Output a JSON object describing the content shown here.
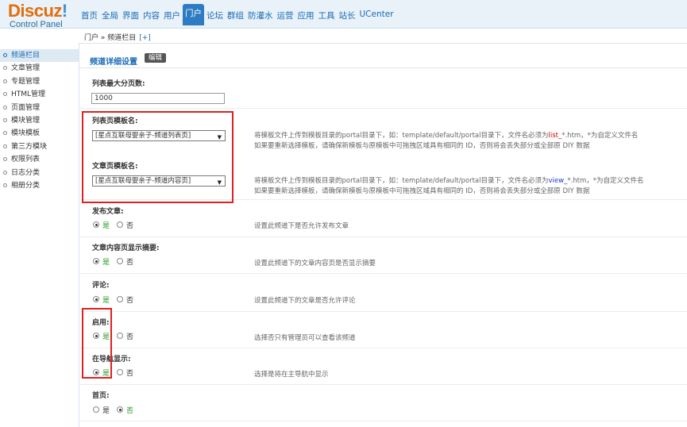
{
  "logo": {
    "main": "Discuz",
    "excl": "!",
    "sub": "Control Panel"
  },
  "topnav": [
    {
      "label": "首页",
      "active": false
    },
    {
      "label": "全局",
      "active": false
    },
    {
      "label": "界面",
      "active": false
    },
    {
      "label": "内容",
      "active": false
    },
    {
      "label": "用户",
      "active": false
    },
    {
      "label": "门户",
      "active": true
    },
    {
      "label": "论坛",
      "active": false
    },
    {
      "label": "群组",
      "active": false
    },
    {
      "label": "防灌水",
      "active": false
    },
    {
      "label": "运营",
      "active": false
    },
    {
      "label": "应用",
      "active": false
    },
    {
      "label": "工具",
      "active": false
    },
    {
      "label": "站长",
      "active": false
    },
    {
      "label": "UCenter",
      "active": false
    }
  ],
  "breadcrumb": {
    "path": "门户 » 频道栏目",
    "plus": "[+]"
  },
  "sidebar": [
    {
      "label": "频道栏目",
      "active": true
    },
    {
      "label": "文章管理",
      "active": false
    },
    {
      "label": "专题管理",
      "active": false
    },
    {
      "label": "HTML管理",
      "active": false
    },
    {
      "label": "页面管理",
      "active": false
    },
    {
      "label": "模块管理",
      "active": false
    },
    {
      "label": "模块模板",
      "active": false
    },
    {
      "label": "第三方模块",
      "active": false
    },
    {
      "label": "权限列表",
      "active": false
    },
    {
      "label": "日志分类",
      "active": false
    },
    {
      "label": "相册分类",
      "active": false
    }
  ],
  "section": {
    "title": "频道详细设置",
    "edit_label": "编辑"
  },
  "fields": {
    "max_pages": {
      "label": "列表最大分页数:",
      "value": "1000"
    },
    "list_tpl": {
      "label": "列表页模板名:",
      "selected": "[星点互联母婴亲子-频道列表页]",
      "tip_prefix": "将模板文件上传到模板目录的portal目录下，如：template/default/portal目录下，文件名必须为",
      "tip_highlight": "list_",
      "tip_suffix": "*.htm，*为自定义文件名",
      "tip_line2": "如果要重新选择模板，请确保新模板与原模板中可拖拽区域具有相同的 ID，否则将会丢失部分或全部原 DIY 数据"
    },
    "article_tpl": {
      "label": "文章页模板名:",
      "selected": "[星点互联母婴亲子-频道内容页]",
      "tip_prefix": "将模板文件上传到模板目录的portal目录下，如：template/default/portal目录下，文件名必须为",
      "tip_highlight": "view_",
      "tip_suffix": "*.htm，*为自定义文件名",
      "tip_line2": "如果要重新选择模板，请确保新模板与原模板中可拖拽区域具有相同的 ID，否则将会丢失部分或全部原 DIY 数据"
    },
    "publish": {
      "label": "发布文章:",
      "yes": "是",
      "no": "否",
      "value": "yes",
      "tip": "设置此频道下是否允许发布文章"
    },
    "summary": {
      "label": "文章内容页显示摘要:",
      "yes": "是",
      "no": "否",
      "value": "yes",
      "tip": "设置此频道下的文章内容页是否显示摘要"
    },
    "comment": {
      "label": "评论:",
      "yes": "是",
      "no": "否",
      "value": "yes",
      "tip": "设置此频道下的文章是否允许评论"
    },
    "enable": {
      "label": "启用:",
      "yes": "是",
      "no": "否",
      "value": "yes",
      "tip": "选择否只有管理员可以查看该频道"
    },
    "nav_show": {
      "label": "在导航显示:",
      "yes": "是",
      "no": "否",
      "value": "yes",
      "tip": "选择是将在主导航中显示"
    },
    "homepage": {
      "label": "首页:",
      "yes": "是",
      "no": "否",
      "value": "no",
      "tip": ""
    }
  }
}
